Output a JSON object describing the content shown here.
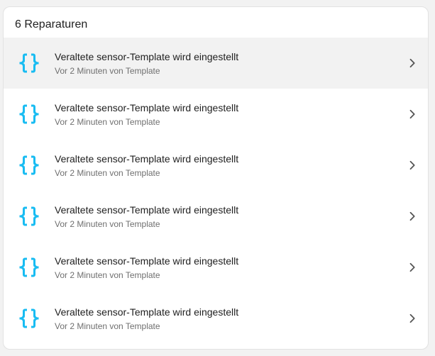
{
  "header": {
    "title": "6 Reparaturen"
  },
  "colors": {
    "accent": "#18bcf2",
    "text_primary": "#212121",
    "text_secondary": "#6f6f6f",
    "highlight": "#f2f2f2"
  },
  "repairs": [
    {
      "icon": "code-braces-icon",
      "title": "Veraltete sensor-Template wird eingestellt",
      "subtitle": "Vor 2 Minuten von Template",
      "highlighted": true
    },
    {
      "icon": "code-braces-icon",
      "title": "Veraltete sensor-Template wird eingestellt",
      "subtitle": "Vor 2 Minuten von Template",
      "highlighted": false
    },
    {
      "icon": "code-braces-icon",
      "title": "Veraltete sensor-Template wird eingestellt",
      "subtitle": "Vor 2 Minuten von Template",
      "highlighted": false
    },
    {
      "icon": "code-braces-icon",
      "title": "Veraltete sensor-Template wird eingestellt",
      "subtitle": "Vor 2 Minuten von Template",
      "highlighted": false
    },
    {
      "icon": "code-braces-icon",
      "title": "Veraltete sensor-Template wird eingestellt",
      "subtitle": "Vor 2 Minuten von Template",
      "highlighted": false
    },
    {
      "icon": "code-braces-icon",
      "title": "Veraltete sensor-Template wird eingestellt",
      "subtitle": "Vor 2 Minuten von Template",
      "highlighted": false
    }
  ]
}
